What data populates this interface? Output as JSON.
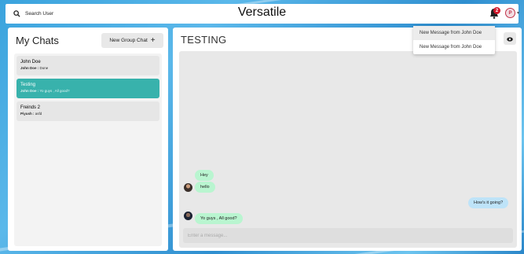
{
  "header": {
    "search_label": "Search User",
    "app_title": "Versatile",
    "notification_count": "2",
    "avatar_initial": "P"
  },
  "notifications": [
    {
      "label": "New Message from John Doe"
    },
    {
      "label": "New Message from John Doe"
    }
  ],
  "sidebar": {
    "title": "My Chats",
    "new_group_label": "New Group Chat",
    "new_group_icon": "+",
    "chats": [
      {
        "name": "John Doe",
        "sender": "John Doe :",
        "preview": "Done",
        "active": false
      },
      {
        "name": "Testing",
        "sender": "John Doe :",
        "preview": "Yo guys , All good?",
        "active": true
      },
      {
        "name": "Freinds 2",
        "sender": "Piyush :",
        "preview": "asfd",
        "active": false
      }
    ]
  },
  "chat": {
    "title": "TESTING",
    "messages": [
      {
        "text": "Hey",
        "direction": "in"
      },
      {
        "text": "hello",
        "direction": "in"
      },
      {
        "text": "How's it going?",
        "direction": "out"
      },
      {
        "text": "Yo guys , All good?",
        "direction": "in"
      }
    ],
    "input_placeholder": "Enter a message..."
  },
  "colors": {
    "accent": "#38b2ac",
    "incoming_bubble": "#b9f5d0",
    "outgoing_bubble": "#bee3f8",
    "badge": "#d0172a"
  }
}
